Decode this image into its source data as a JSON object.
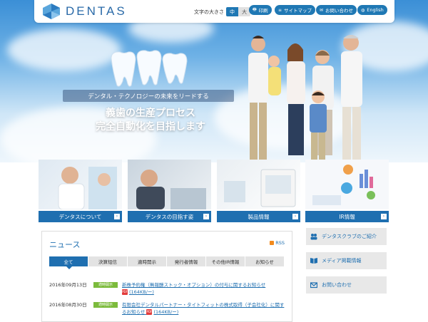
{
  "header": {
    "logo_text": "DENTAS",
    "font_size_label": "文字の大きさ",
    "font_size_options": [
      "中",
      "大"
    ],
    "buttons": [
      {
        "label": "印刷",
        "icon": "print-icon"
      },
      {
        "label": "サイトマップ",
        "icon": "sitemap-icon"
      },
      {
        "label": "お問い合わせ",
        "icon": "mail-icon"
      },
      {
        "label": "English",
        "icon": "globe-icon"
      }
    ]
  },
  "hero": {
    "tagline": "デンタル・テクノロジーの未来をリードする",
    "headline_line1": "義歯の生産プロセス",
    "headline_line2": "完全自動化を目指します"
  },
  "tiles": [
    {
      "label": "デンタスについて"
    },
    {
      "label": "デンタスの目指す姿"
    },
    {
      "label": "製品情報"
    },
    {
      "label": "IR情報"
    }
  ],
  "news": {
    "title": "ニュース",
    "rss_label": "RSS",
    "tabs": [
      "全て",
      "決算短信",
      "適時開示",
      "発行者情報",
      "その他IR情報",
      "お知らせ"
    ],
    "items": [
      {
        "date": "2016年09月13日",
        "badge": "適時開示",
        "text": "新株予約権（無報酬ストック・オプション）の付与に関するお知らせ",
        "size": "(164KB/ー)"
      },
      {
        "date": "2016年08月30日",
        "badge": "適時開示",
        "text": "有限会社デンタルパートナー・タイトフィットの株式取得（子会社化）に関するお知らせ",
        "size": "(164KB/ー)"
      }
    ]
  },
  "side_links": [
    {
      "label": "デンタスクラブのご紹介",
      "icon": "people-icon"
    },
    {
      "label": "メディア掲載情報",
      "icon": "book-icon"
    },
    {
      "label": "お問い合わせ",
      "icon": "mail-icon"
    }
  ],
  "colors": {
    "accent": "#1f6fb0",
    "badge": "#7cbb3c"
  }
}
